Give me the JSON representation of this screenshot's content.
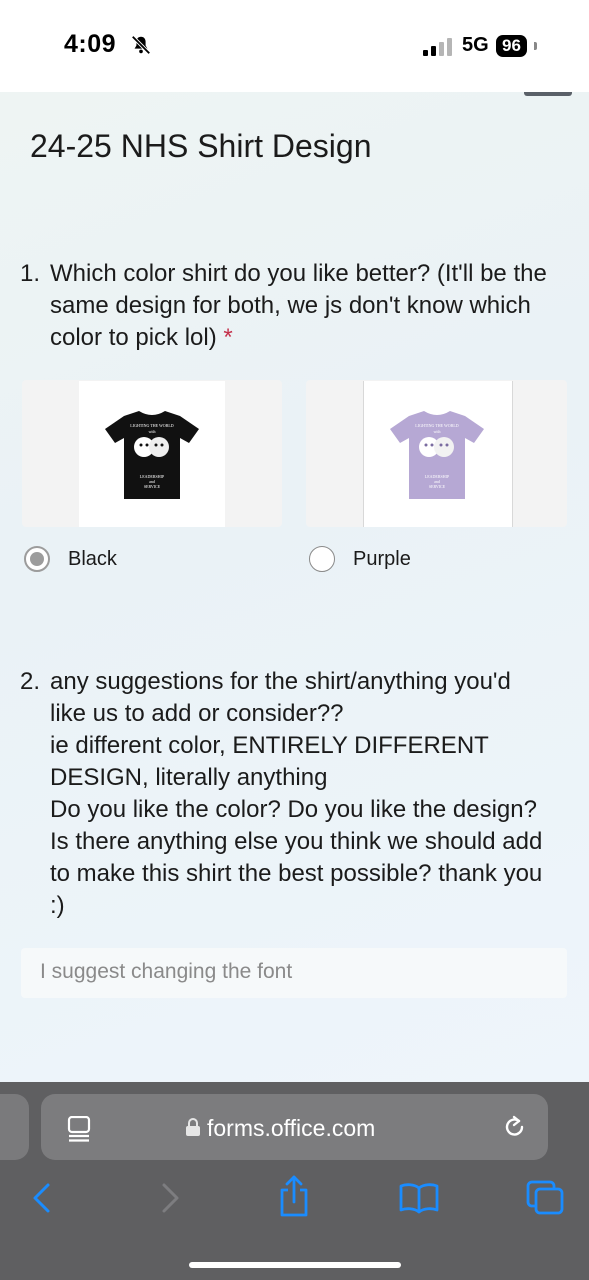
{
  "status_bar": {
    "time": "4:09",
    "network": "5G",
    "battery": "96",
    "icons": [
      "bell-slash-icon",
      "signal-icon"
    ]
  },
  "form": {
    "title": "24-25 NHS Shirt Design",
    "questions": [
      {
        "number": "1.",
        "text": "Which color shirt do you like better? (It'll be the same design for both, we js don't know which color to pick lol)",
        "required_mark": "*",
        "options": [
          {
            "label": "Black",
            "selected": true,
            "shirt_color": "#111111",
            "shirt_text": [
              "LIGHTING THE WORLD",
              "with",
              "LEADERSHIP",
              "and",
              "SERVICE"
            ]
          },
          {
            "label": "Purple",
            "selected": false,
            "shirt_color": "#b6a8d4",
            "shirt_text": [
              "LIGHTING THE WORLD",
              "with",
              "LEADERSHIP",
              "and",
              "SERVICE"
            ]
          }
        ]
      },
      {
        "number": "2.",
        "lines": [
          "any suggestions for the shirt/anything you'd",
          "like us to add or consider??",
          "ie different color, ENTIRELY DIFFERENT",
          "DESIGN, literally anything",
          "Do you like the color? Do you like the design?",
          "Is there anything else you think we should add",
          "to make this shirt the best possible? thank you",
          ":)"
        ],
        "answer": "I suggest changing the font"
      }
    ]
  },
  "browser": {
    "url": "forms.office.com",
    "icons": [
      "reader-icon",
      "lock-icon",
      "reload-icon",
      "back-icon",
      "forward-icon",
      "share-icon",
      "bookmarks-icon",
      "tabs-icon"
    ]
  },
  "colors": {
    "accent_blue": "#1a8cff",
    "required_red": "#c4314b"
  }
}
